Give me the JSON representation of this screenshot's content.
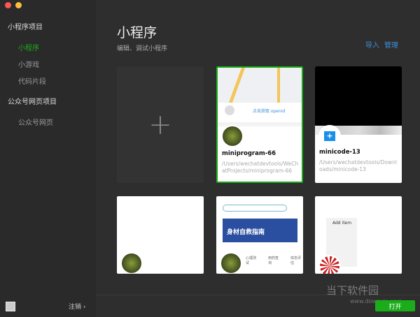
{
  "sidebar": {
    "section1": "小程序项目",
    "items1": [
      "小程序",
      "小游戏",
      "代码片段"
    ],
    "section2": "公众号网页项目",
    "items2": [
      "公众号网页"
    ],
    "logout": "注销 ›"
  },
  "main": {
    "title": "小程序",
    "subtitle": "编辑、调试小程序",
    "import": "导入",
    "manage": "管理"
  },
  "projects": [
    {
      "name": "miniprogram-66",
      "path": "/Users/wechatdevtools/WeChatProjects/miniprogram-66",
      "preview_text": "点击获取 openid"
    },
    {
      "name": "minicode-13",
      "path": "/Users/wechatdevtools/Downloads/minicode-13"
    },
    {
      "preview_text": "Add item"
    }
  ],
  "promo": {
    "banner": "身材自救指南",
    "tabs": [
      "心理测试",
      "用药查询",
      "体态评估"
    ]
  },
  "footer": {
    "open": "打开"
  },
  "watermark": {
    "brand": "当下软件园",
    "url": "www.downxia.com"
  },
  "colors": {
    "accent": "#1aad19",
    "link": "#3b8fd9"
  }
}
